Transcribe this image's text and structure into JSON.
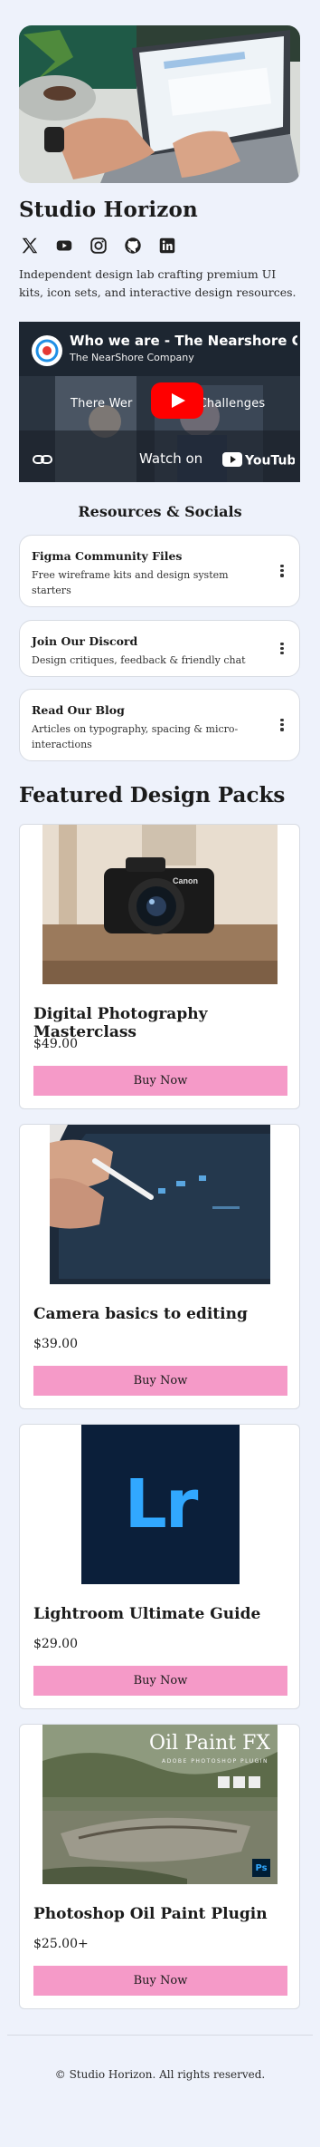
{
  "profile": {
    "name": "Studio Horizon",
    "bio": "Independent design lab crafting premium UI kits, icon sets, and interactive design resources.",
    "socials": [
      {
        "icon": "x-icon"
      },
      {
        "icon": "youtube-icon"
      },
      {
        "icon": "instagram-icon"
      },
      {
        "icon": "github-icon"
      },
      {
        "icon": "linkedin-icon"
      }
    ]
  },
  "video": {
    "title": "Who we are - The Nearshore Com",
    "channel": "The NearShore Company",
    "caption_left": "There Wer",
    "caption_right": "Challenges",
    "watch_on": "Watch on",
    "brand": "YouTube",
    "play_color": "#ff0000"
  },
  "resources": {
    "heading": "Resources & Socials",
    "items": [
      {
        "title": "Figma Community Files",
        "description": "Free wireframe kits and design system starters"
      },
      {
        "title": "Join Our Discord",
        "description": "Design critiques, feedback & friendly chat"
      },
      {
        "title": "Read Our Blog",
        "description": "Articles on typography, spacing & micro-interactions"
      }
    ]
  },
  "featured": {
    "heading": "Featured Design Packs",
    "products": [
      {
        "title": "Digital Photography Masterclass",
        "price": "$49.00",
        "button": "Buy Now"
      },
      {
        "title": "Camera basics to editing",
        "price": "$39.00",
        "button": "Buy Now"
      },
      {
        "title": "Lightroom Ultimate Guide",
        "price": "$29.00",
        "button": "Buy Now",
        "logo_text": "Lr"
      },
      {
        "title": "Photoshop Oil Paint Plugin",
        "price": "$25.00+",
        "button": "Buy Now",
        "banner_title": "Oil Paint FX",
        "banner_subtitle": "ADOBE PHOTOSHOP PLUGIN",
        "badge": "Ps"
      }
    ]
  },
  "footer": {
    "text": "© Studio Horizon. All rights reserved."
  },
  "colors": {
    "background": "#eef2fb",
    "button": "#f59ac8",
    "lightroom_bg": "#0b1f3a",
    "lightroom_text": "#31a8ff"
  }
}
